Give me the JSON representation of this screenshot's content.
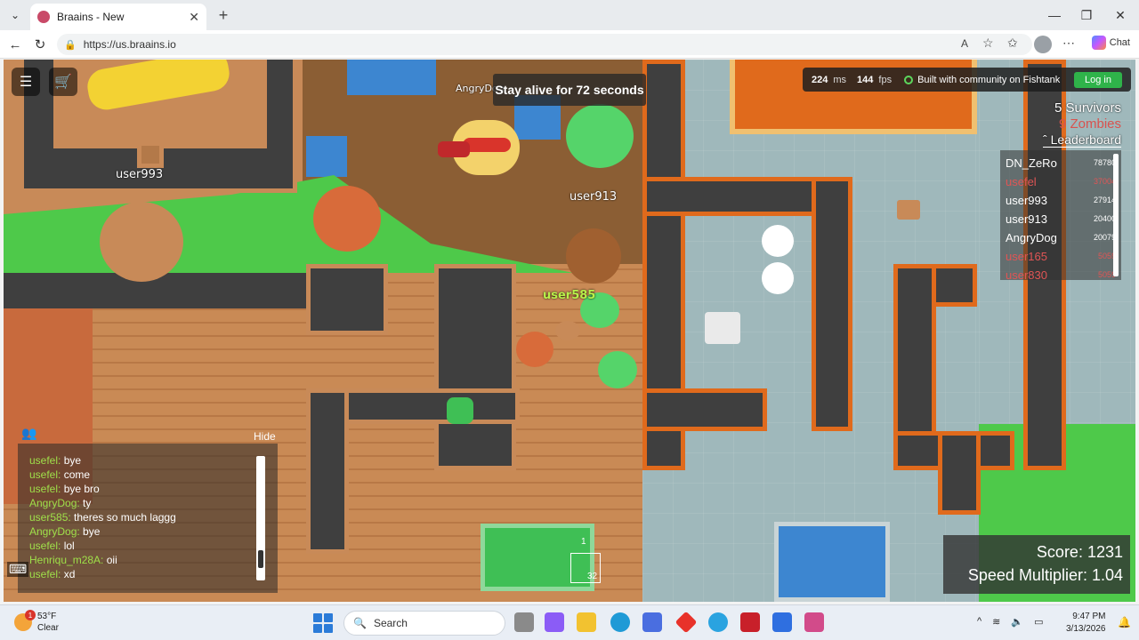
{
  "browser": {
    "tab_title": "Braains - New",
    "url": "https://us.braains.io",
    "chat_label": "Chat"
  },
  "game": {
    "objective": "Stay alive for 72 seconds",
    "ping_value": "224",
    "ping_unit": "ms",
    "fps_value": "144",
    "fps_unit": "fps",
    "community_text": "Built with community on Fishtank",
    "login_label": "Log in",
    "survivors": "5 Survivors",
    "zombies": "9 Zombies",
    "leaderboard_label": "Leaderboard",
    "leaderboard": [
      {
        "name": "DN_ZeRo",
        "score": "78780",
        "zombie": false
      },
      {
        "name": "usefel",
        "score": "37004",
        "zombie": true
      },
      {
        "name": "user993",
        "score": "27914",
        "zombie": false
      },
      {
        "name": "user913",
        "score": "20400",
        "zombie": false
      },
      {
        "name": "AngryDog",
        "score": "20079",
        "zombie": false
      },
      {
        "name": "user165",
        "score": "5059",
        "zombie": true
      },
      {
        "name": "user830",
        "score": "5059",
        "zombie": true
      }
    ],
    "player_names": {
      "p1": "user993",
      "p2": "user913",
      "p3": "AngryDog",
      "p4": "user585"
    },
    "chat_hide_label": "Hide",
    "chat": [
      {
        "user": "usefel:",
        "msg": "bye"
      },
      {
        "user": "usefel:",
        "msg": "come"
      },
      {
        "user": "usefel:",
        "msg": "bye bro"
      },
      {
        "user": "AngryDog:",
        "msg": "ty"
      },
      {
        "user": "user585:",
        "msg": "theres so much laggg"
      },
      {
        "user": "AngryDog:",
        "msg": "bye"
      },
      {
        "user": "usefel:",
        "msg": "lol"
      },
      {
        "user": "Henriqu_m28A:",
        "msg": "oii"
      },
      {
        "user": "usefel:",
        "msg": "xd"
      }
    ],
    "score_label": "Score: 1231",
    "speed_label": "Speed Multiplier: 1.04",
    "minimap_top": "1",
    "minimap_bottom": "32"
  },
  "taskbar": {
    "weather_temp": "53°F",
    "weather_cond": "Clear",
    "weather_badge": "1",
    "search_label": "Search",
    "time": "9:47 PM",
    "date": "3/13/2026"
  }
}
